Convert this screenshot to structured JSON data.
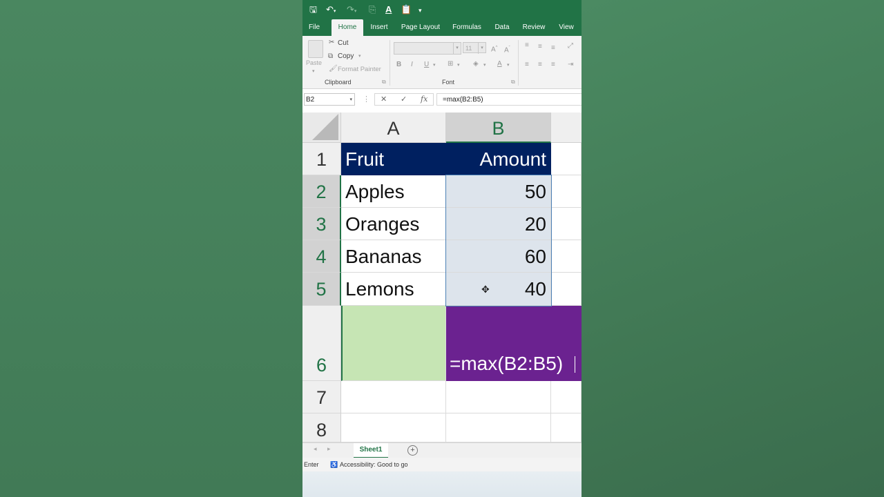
{
  "quick_access": {
    "save_icon": "save-icon",
    "undo_icon": "undo-icon",
    "redo_icon": "redo-icon",
    "format_icon": "font-color-icon",
    "customize_icon": "dropdown-icon"
  },
  "tabs": [
    "File",
    "Home",
    "Insert",
    "Page Layout",
    "Formulas",
    "Data",
    "Review",
    "View"
  ],
  "active_tab": "Home",
  "ribbon": {
    "clipboard": {
      "paste_label": "Paste",
      "cut_label": "Cut",
      "copy_label": "Copy",
      "format_painter_label": "Format Painter",
      "group_label": "Clipboard"
    },
    "font": {
      "font_size": "11",
      "bold": "B",
      "italic": "I",
      "underline": "U",
      "group_label": "Font"
    }
  },
  "formula_bar": {
    "name_box": "B2",
    "cancel": "✕",
    "enter": "✓",
    "fx": "fx",
    "formula": "=max(B2:B5)"
  },
  "columns": [
    "A",
    "B"
  ],
  "rows": [
    "1",
    "2",
    "3",
    "4",
    "5",
    "6",
    "7",
    "8"
  ],
  "table": {
    "headers": [
      "Fruit",
      "Amount"
    ],
    "data": [
      {
        "fruit": "Apples",
        "amount": "50"
      },
      {
        "fruit": "Oranges",
        "amount": "20"
      },
      {
        "fruit": "Bananas",
        "amount": "60"
      },
      {
        "fruit": "Lemons",
        "amount": "40"
      }
    ]
  },
  "editing_cell": {
    "ref": "B6",
    "text": "=max(B2:B5)"
  },
  "sheet_tabs": [
    "Sheet1"
  ],
  "status_bar": {
    "mode": "Enter",
    "accessibility": "Accessibility: Good to go"
  },
  "colors": {
    "excel_green": "#217346",
    "header_fill": "#002060",
    "green_fill": "#c6e5b4",
    "purple_fill": "#6b2290",
    "background": "#477f5c"
  }
}
